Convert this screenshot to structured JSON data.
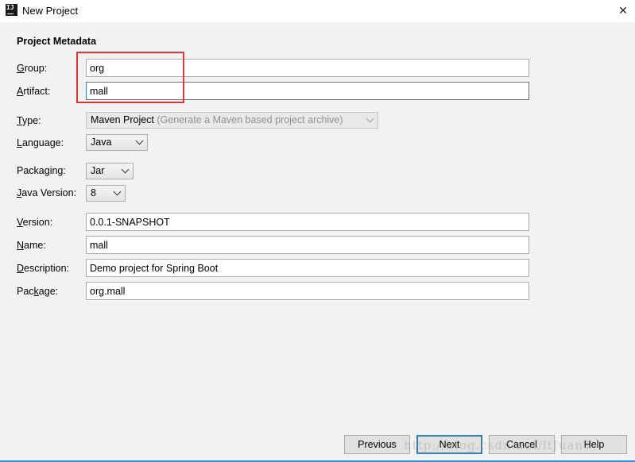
{
  "window": {
    "icon_text": "IJ",
    "title": "New Project",
    "close_glyph": "✕"
  },
  "section": {
    "title": "Project Metadata"
  },
  "fields": {
    "group": {
      "label_key": "G",
      "label_rest": "roup:",
      "value": "org"
    },
    "artifact": {
      "label_key": "A",
      "label_rest": "rtifact:",
      "value": "mall"
    },
    "version": {
      "label_key": "V",
      "label_rest": "ersion:",
      "value": "0.0.1-SNAPSHOT"
    },
    "name": {
      "label_key": "N",
      "label_rest": "ame:",
      "value": "mall"
    },
    "description": {
      "label_key": "D",
      "label_rest": "escription:",
      "value": "Demo project for Spring Boot"
    },
    "package": {
      "label_pre": "Pac",
      "label_key": "k",
      "label_rest": "age:",
      "value": "org.mall"
    }
  },
  "combos": {
    "type": {
      "label_key": "T",
      "label_rest": "ype:",
      "value": "Maven Project",
      "hint": "(Generate a Maven based project archive)"
    },
    "language": {
      "label_key": "L",
      "label_rest": "anguage:",
      "value": "Java"
    },
    "packaging": {
      "label_pre": "Packa",
      "label_key": "g",
      "label_rest": "ing:",
      "value": "Jar"
    },
    "java_version": {
      "label_key": "J",
      "label_rest": "ava Version:",
      "value": "8"
    }
  },
  "buttons": {
    "previous": "Previous",
    "next": "Next",
    "cancel": "Cancel",
    "help": "Help"
  },
  "watermark": "http://blog.csdn.net/ltJuanT",
  "colors": {
    "accent": "#3c7fb1",
    "highlight": "#e0373a",
    "background": "#f2f2f2"
  }
}
